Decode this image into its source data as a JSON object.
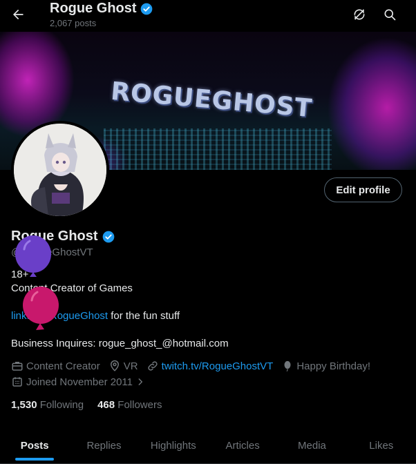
{
  "header": {
    "title": "Rogue Ghost",
    "post_count": "2,067 posts"
  },
  "banner": {
    "text": "ROGUEGHOST"
  },
  "profile": {
    "edit_button": "Edit profile",
    "name": "Rogue Ghost",
    "handle": "@RogueGhostVT",
    "bio": {
      "line1": "18+",
      "line2": "Content Creator of Games",
      "link_text": "linktr.ee/RogueGhost",
      "link_suffix": " for the fun stuff",
      "business": "Business Inquires: rogue_ghost_@hotmail.com"
    },
    "meta": {
      "category": "Content Creator",
      "location": "VR",
      "website": "twitch.tv/RogueGhostVT",
      "birthday": "Happy Birthday!",
      "joined": "Joined November 2011"
    },
    "following_count": "1,530",
    "following_label": "Following",
    "followers_count": "468",
    "followers_label": "Followers"
  },
  "tabs": [
    {
      "label": "Posts",
      "active": true
    },
    {
      "label": "Replies",
      "active": false
    },
    {
      "label": "Highlights",
      "active": false
    },
    {
      "label": "Articles",
      "active": false
    },
    {
      "label": "Media",
      "active": false
    },
    {
      "label": "Likes",
      "active": false
    }
  ],
  "colors": {
    "accent": "#1d9bf0",
    "balloon_purple": "#6a3fc8",
    "balloon_pink": "#c8186c"
  },
  "icons": [
    "back-arrow-icon",
    "verified-badge-icon",
    "sync-icon",
    "search-icon",
    "briefcase-icon",
    "location-icon",
    "link-icon",
    "balloon-icon",
    "calendar-icon",
    "chevron-right-icon"
  ]
}
